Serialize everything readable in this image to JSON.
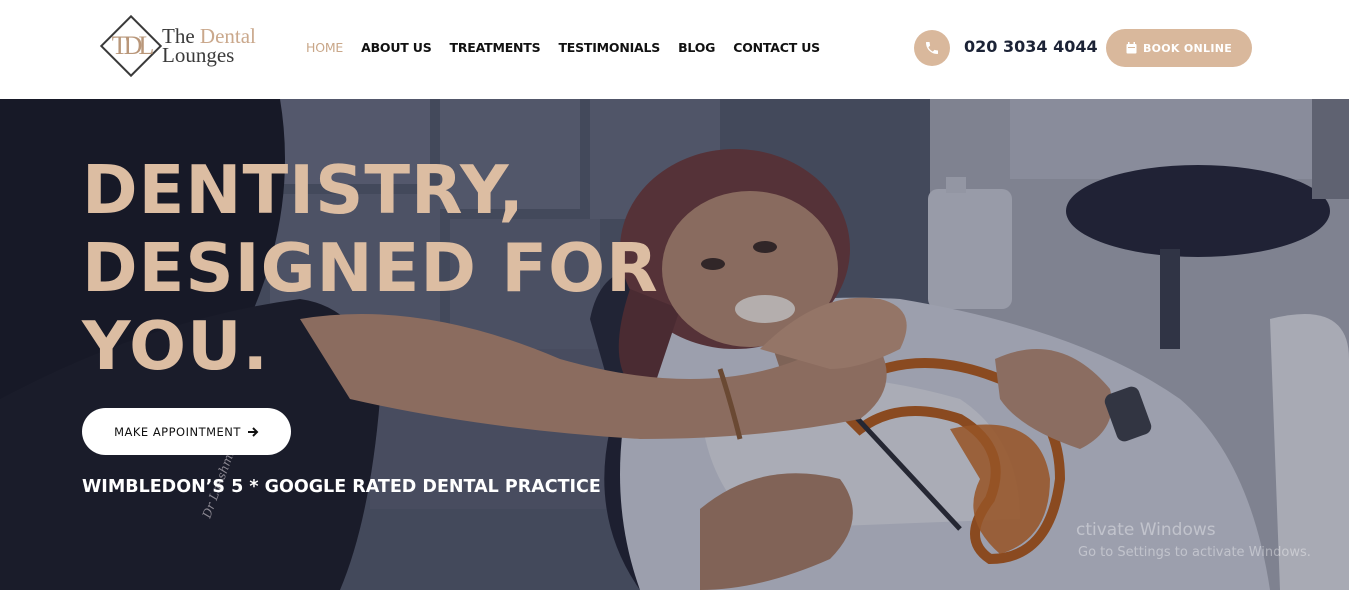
{
  "logo": {
    "monogram": "TDL",
    "line1_a": "The ",
    "line1_b": "Dental",
    "line2": "Lounges"
  },
  "nav": {
    "items": [
      "HOME",
      "ABOUT US",
      "TREATMENTS",
      "TESTIMONIALS",
      "BLOG",
      "CONTACT US"
    ],
    "active": "HOME"
  },
  "contact": {
    "phone": "020 3034 4044",
    "book_label": "BOOK ONLINE"
  },
  "hero": {
    "headline": [
      "DENTISTRY,",
      "DESIGNED FOR",
      "YOU."
    ],
    "cta_label": "MAKE APPOINTMENT",
    "tagline": "WIMBLEDON’S 5 * GOOGLE RATED DENTAL PRACTICE",
    "embroidery": "Dr Lakshmi"
  },
  "watermark": {
    "line1": "ctivate Windows",
    "line2": "Go to Settings to activate Windows."
  },
  "colors": {
    "accent": "#d9b89c",
    "headline": "#dcbda2",
    "nav_active": "#c9a789",
    "dark_text": "#1c2336"
  },
  "icons": [
    "phone-icon",
    "calendar-icon",
    "arrow-right-icon"
  ]
}
